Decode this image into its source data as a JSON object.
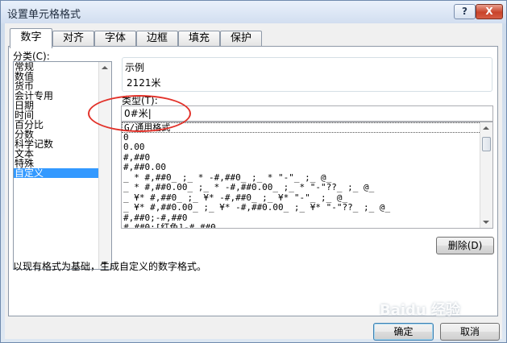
{
  "window": {
    "title": "设置单元格格式",
    "help": "?",
    "close": "X"
  },
  "tabs": [
    "数字",
    "对齐",
    "字体",
    "边框",
    "填充",
    "保护"
  ],
  "category": {
    "label": "分类(C):",
    "items": [
      "常规",
      "数值",
      "货币",
      "会计专用",
      "日期",
      "时间",
      "百分比",
      "分数",
      "科学记数",
      "文本",
      "特殊",
      "自定义"
    ],
    "selected": "自定义"
  },
  "sample": {
    "label": "示例",
    "value": "2121米"
  },
  "type": {
    "label": "类型(T):",
    "value": "0#米|"
  },
  "formats": [
    "G/通用格式",
    "0",
    "0.00",
    "#,##0",
    "#,##0.00",
    "_ * #,##0_ ;_ * -#,##0_ ;_ * \"-\"_ ;_ @_",
    "_ * #,##0.00_ ;_ * -#,##0.00_ ;_ * \"-\"??_ ;_ @_",
    "_ ¥* #,##0_ ;_ ¥* -#,##0_ ;_ ¥* \"-\"_ ;_ @_",
    "_ ¥* #,##0.00_ ;_ ¥* -#,##0.00_ ;_ ¥* \"-\"??_ ;_ @_",
    "#,##0;-#,##0",
    "#,##0;[红色]-#,##0"
  ],
  "buttons": {
    "delete": "删除(D)",
    "ok": "确定",
    "cancel": "取消"
  },
  "description": "以现有格式为基础，生成自定义的数字格式。",
  "watermark": "Baidu 经验",
  "colors": {
    "selection": "#3399ff",
    "annotation": "#e2322a"
  }
}
